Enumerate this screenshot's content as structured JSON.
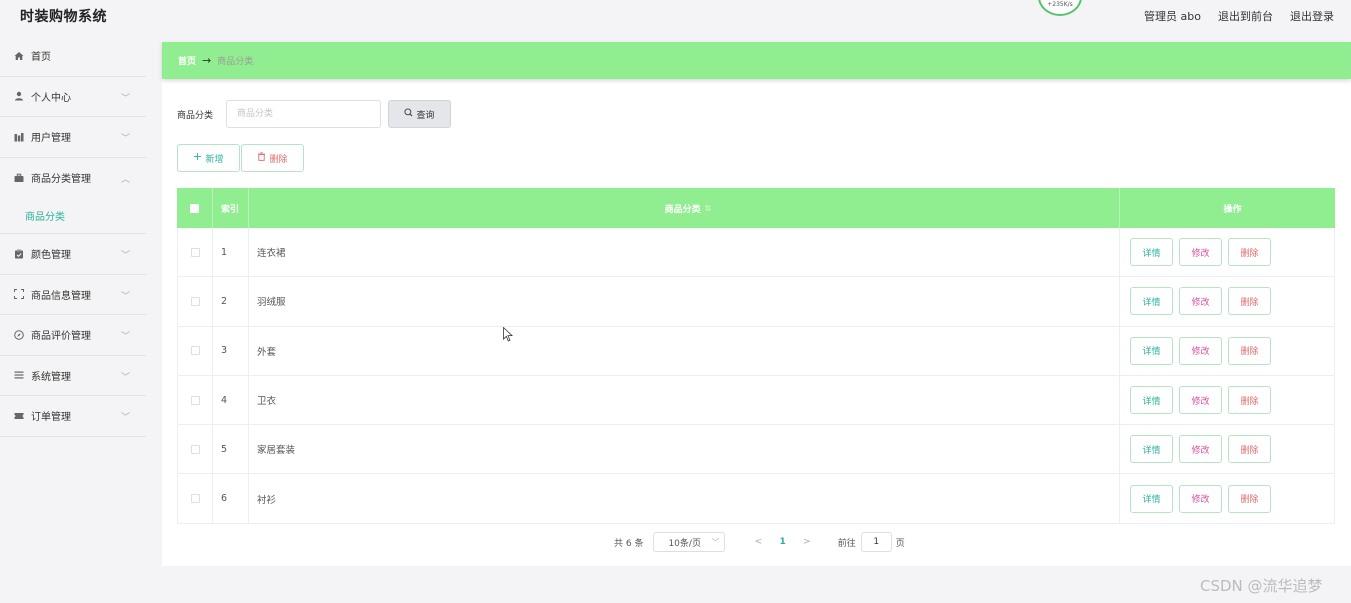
{
  "header": {
    "app_title": "时装购物系统",
    "speed_text": "+235K/s",
    "admin_label": "管理员 abo",
    "back_to_front": "退出到前台",
    "logout": "退出登录"
  },
  "sidebar": {
    "items": [
      {
        "label": "首页",
        "icon": "home-icon",
        "has_chevron": false
      },
      {
        "label": "个人中心",
        "icon": "user-icon",
        "has_chevron": true
      },
      {
        "label": "用户管理",
        "icon": "chart-icon",
        "has_chevron": true
      },
      {
        "label": "商品分类管理",
        "icon": "briefcase-icon",
        "has_chevron": true,
        "expanded": true
      },
      {
        "label": "颜色管理",
        "icon": "clipboard-icon",
        "has_chevron": true
      },
      {
        "label": "商品信息管理",
        "icon": "frame-icon",
        "has_chevron": true
      },
      {
        "label": "商品评价管理",
        "icon": "compass-icon",
        "has_chevron": true
      },
      {
        "label": "系统管理",
        "icon": "list-icon",
        "has_chevron": true
      },
      {
        "label": "订单管理",
        "icon": "ticket-icon",
        "has_chevron": true
      }
    ],
    "submenu_active": "商品分类"
  },
  "breadcrumb": {
    "home": "首页",
    "arrow": "→",
    "current": "商品分类"
  },
  "search": {
    "label": "商品分类",
    "placeholder": "商品分类",
    "query_button": "查询"
  },
  "actions": {
    "add": "新增",
    "delete": "删除"
  },
  "table": {
    "headers": {
      "index": "索引",
      "name": "商品分类",
      "ops": "操作"
    },
    "rows": [
      {
        "index": "1",
        "name": "连衣裙"
      },
      {
        "index": "2",
        "name": "羽绒服"
      },
      {
        "index": "3",
        "name": "外套"
      },
      {
        "index": "4",
        "name": "卫衣"
      },
      {
        "index": "5",
        "name": "家居套装"
      },
      {
        "index": "6",
        "name": "衬衫"
      }
    ],
    "row_ops": {
      "detail": "详情",
      "edit": "修改",
      "delete": "删除"
    }
  },
  "pagination": {
    "total": "共 6 条",
    "page_size": "10条/页",
    "current_page": "1",
    "goto_label": "前往",
    "goto_value": "1",
    "page_suffix": "页"
  },
  "watermark": "CSDN @流华追梦",
  "colors": {
    "accent_green": "#90ee90",
    "text_teal": "#2bb39a",
    "danger": "#e26b6b",
    "edit_pink": "#d94fa0"
  }
}
